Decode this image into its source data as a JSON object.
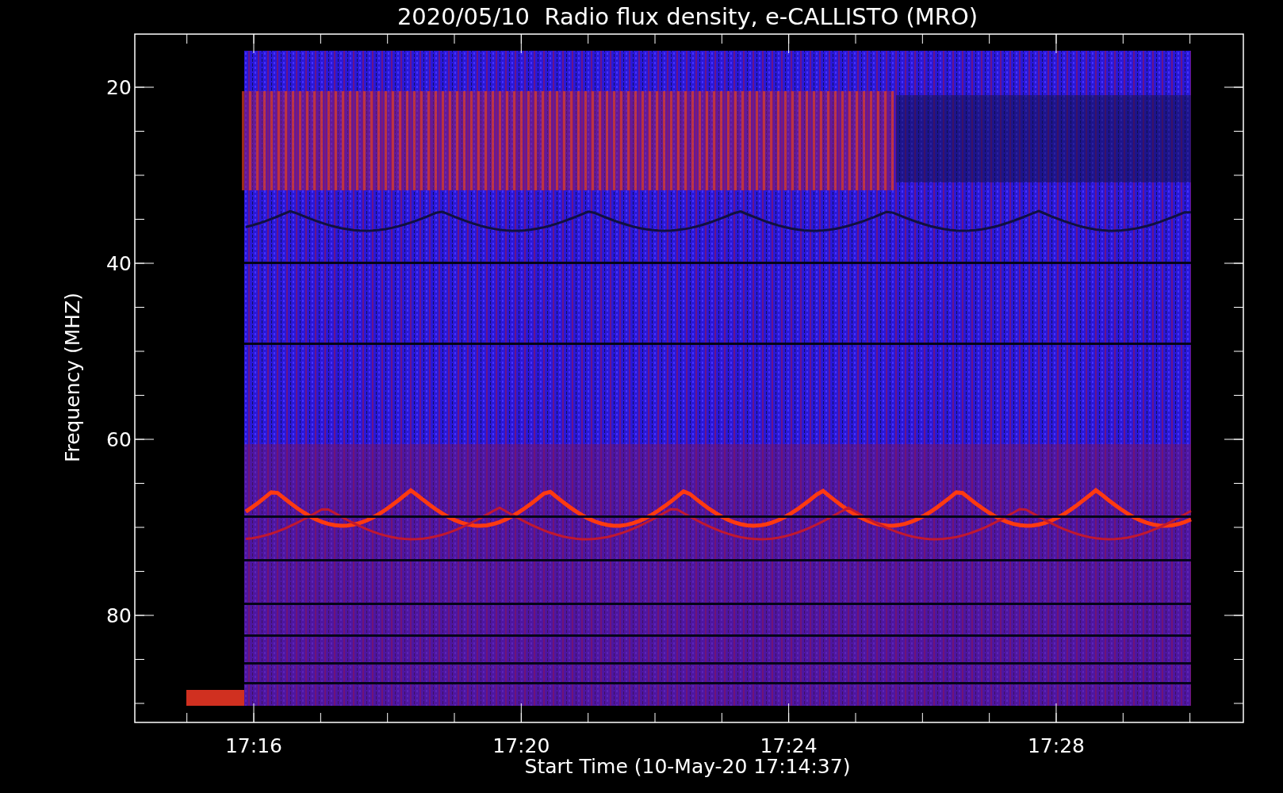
{
  "title": "2020/05/10  Radio flux density, e-CALLISTO (MRO)",
  "ylabel": "Frequency (MHZ)",
  "xlabel": "Start Time (10-May-20 17:14:37)",
  "yticks": [
    "20",
    "40",
    "60",
    "80"
  ],
  "xticks": [
    "17:16",
    "17:20",
    "17:24",
    "17:28"
  ]
}
